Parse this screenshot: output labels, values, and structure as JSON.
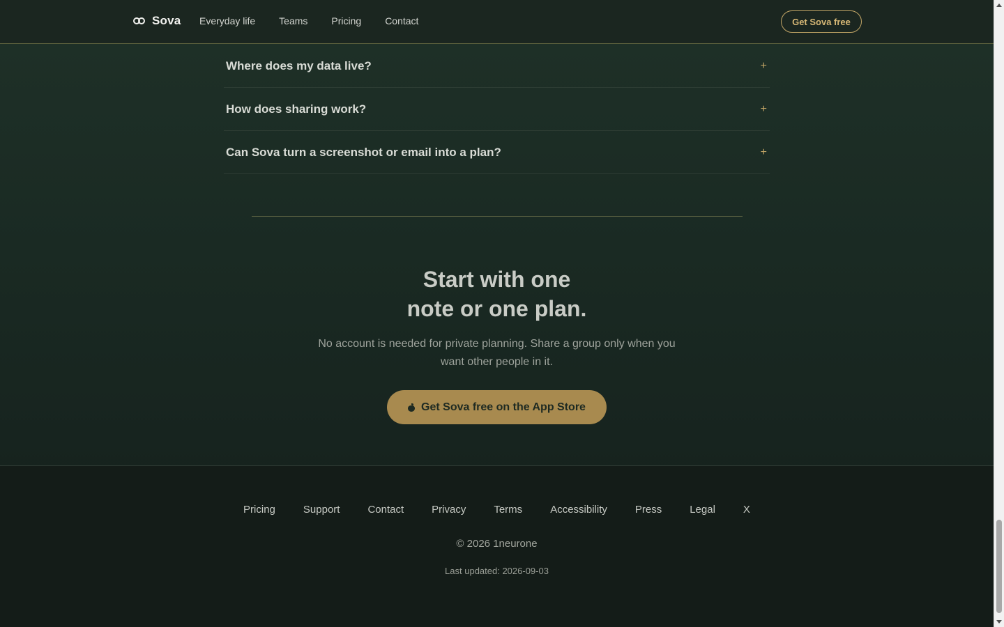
{
  "header": {
    "brand": "Sova",
    "nav": [
      {
        "label": "Everyday life"
      },
      {
        "label": "Teams"
      },
      {
        "label": "Pricing"
      },
      {
        "label": "Contact"
      }
    ],
    "cta_label": "Get Sova free"
  },
  "faq": {
    "items": [
      {
        "question": "Where does my data live?",
        "toggle": "+"
      },
      {
        "question": "How does sharing work?",
        "toggle": "+"
      },
      {
        "question": "Can Sova turn a screenshot or email into a plan?",
        "toggle": "+"
      }
    ]
  },
  "cta": {
    "title_line1": "Start with one",
    "title_line2": "note or one plan.",
    "text": "No account is needed for private planning. Share a group only when you want other people in it.",
    "button_label": "Get Sova free on the App Store",
    "button_icon": "apple-icon"
  },
  "footer": {
    "links": [
      {
        "label": "Pricing"
      },
      {
        "label": "Support"
      },
      {
        "label": "Contact"
      },
      {
        "label": "Privacy"
      },
      {
        "label": "Terms"
      },
      {
        "label": "Accessibility"
      },
      {
        "label": "Press"
      },
      {
        "label": "Legal"
      },
      {
        "label": "X"
      }
    ],
    "copyright": "© 2026 1neurone",
    "updated": "Last updated: 2026-09-03"
  },
  "colors": {
    "accent": "#c4a767",
    "cta_button": "#a88a4f",
    "background": "#1a2a23",
    "footer": "#141c18"
  }
}
